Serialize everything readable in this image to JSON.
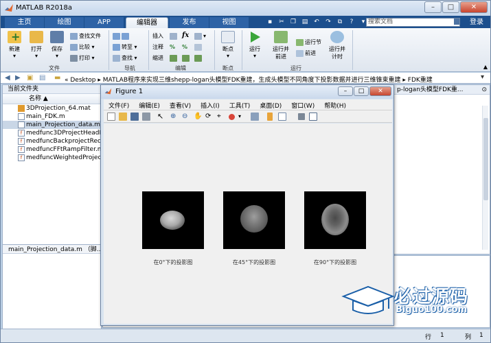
{
  "app": {
    "title": "MATLAB R2018a"
  },
  "tabs": [
    {
      "label": "主页"
    },
    {
      "label": "绘图"
    },
    {
      "label": "APP"
    },
    {
      "label": "编辑器"
    },
    {
      "label": "发布"
    },
    {
      "label": "视图"
    }
  ],
  "search": {
    "placeholder": "搜索文档"
  },
  "login_label": "登录",
  "ribbon": {
    "file": {
      "new": "新建",
      "open": "打开",
      "save": "保存",
      "find_files": "查找文件",
      "compare": "比较",
      "print": "打印",
      "group": "文件"
    },
    "nav": {
      "goto": "转至",
      "find": "查找",
      "group": "导航"
    },
    "edit": {
      "insert": "插入",
      "comment": "注释",
      "indent": "缩进",
      "fx": "fx",
      "group": "编辑"
    },
    "breakpoint": {
      "label": "断点",
      "group": "断点"
    },
    "run": {
      "run": "运行",
      "run_advance_1": "运行并",
      "run_advance_2": "前进",
      "run_section": "运行节",
      "advance": "前进",
      "run_time_1": "运行并",
      "run_time_2": "计时",
      "group": "运行"
    }
  },
  "path": {
    "text": "« Desktop ▸ MATLAB程序来实现三维shepp-logan头模型FDK重建，生成头模型不同角度下投影数据并进行三维锥束重建 ▸ FDK重建"
  },
  "left_pane": {
    "title": "当前文件夹",
    "column": "名称 ▲",
    "files": [
      {
        "name": "3DProjection_64.mat",
        "type": "mat"
      },
      {
        "name": "main_FDK.m",
        "type": "m"
      },
      {
        "name": "main_Projection_data.m",
        "type": "m",
        "selected": true
      },
      {
        "name": "medfunc3DProjectHeadM",
        "type": "fn"
      },
      {
        "name": "medfuncBackprojectReco",
        "type": "fn"
      },
      {
        "name": "medfuncFFtRampFilter.m",
        "type": "fn"
      },
      {
        "name": "medfuncWeightedProject",
        "type": "fn"
      }
    ],
    "details": "main_Projection_data.m （脚..."
  },
  "right_pane": {
    "title": "p-logan头模型FDK重..."
  },
  "status": {
    "row_label": "行",
    "row": "1",
    "col_label": "列",
    "col": "1"
  },
  "figure": {
    "title": "Figure 1",
    "menu": [
      "文件(F)",
      "编辑(E)",
      "查看(V)",
      "插入(I)",
      "工具(T)",
      "桌面(D)",
      "窗口(W)",
      "帮助(H)"
    ],
    "captions": [
      "在0°下的投影图",
      "在45°下的投影图",
      "在90°下的投影图"
    ]
  },
  "watermark": {
    "main": "必过源码",
    "sub": "Biguo100.com"
  },
  "colors": {
    "tabstrip": "#1c4f8d",
    "ribbon": "#eef2f7",
    "figure_bg": "#f0f0f0",
    "accent": "#1a5fa8"
  }
}
